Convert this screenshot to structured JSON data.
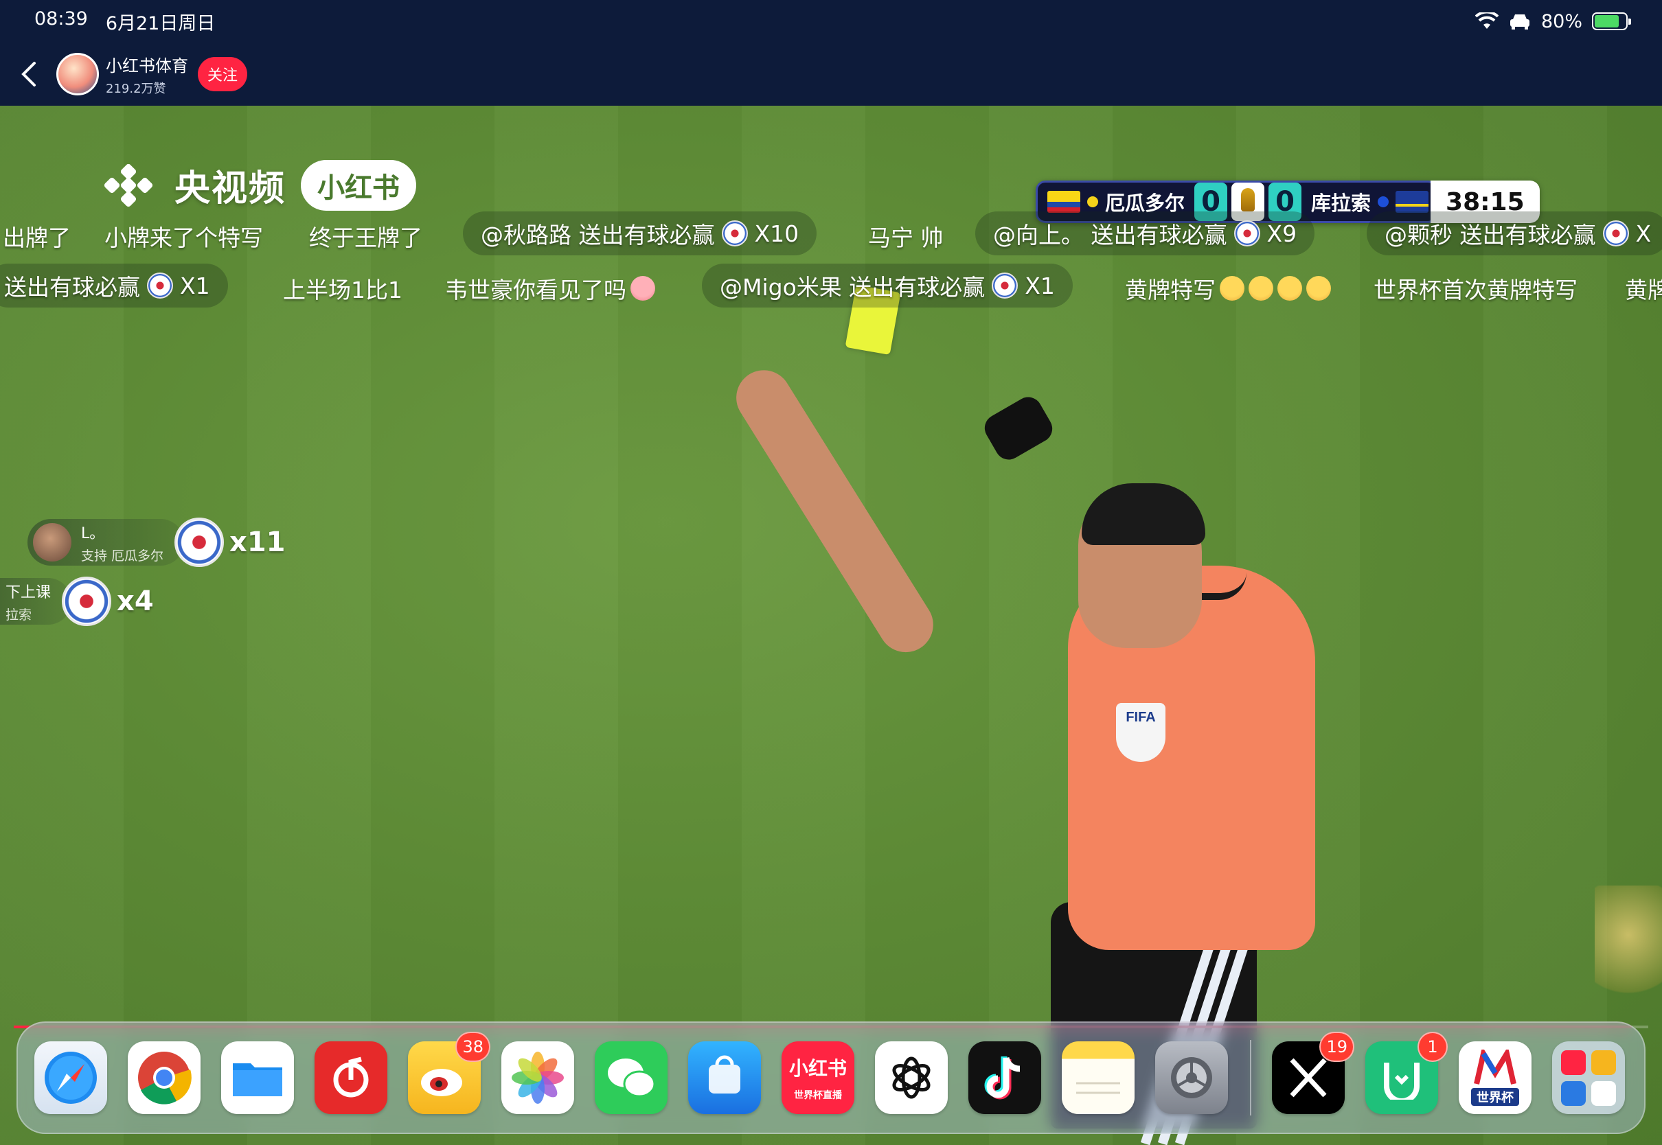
{
  "status_bar": {
    "time": "08:39",
    "date": "6月21日周日",
    "battery_percent": "80%",
    "battery_level": 0.8
  },
  "header": {
    "channel_name": "小红书体育",
    "channel_likes": "219.2万赞",
    "follow_label": "关注"
  },
  "watermark": {
    "text": "央视频",
    "badge": "小红书"
  },
  "scoreboard": {
    "team_left": "厄瓜多尔",
    "score_left": "0",
    "score_right": "0",
    "team_right": "库拉索",
    "match_time": "38:15",
    "dot_left_color": "#f5d21a",
    "dot_right_color": "#1d4fd8"
  },
  "danmaku_row1": [
    "出牌了",
    "小牌来了个特写",
    "终于王牌了",
    "@秋路路 送出有球必赢",
    "X10",
    "马宁 帅",
    "@向上。 送出有球必赢",
    "X9",
    "@颗秒 送出有球必赢",
    "X"
  ],
  "danmaku_row2": [
    "送出有球必赢",
    "X1",
    "上半场1比1",
    "韦世豪你看见了吗",
    "@Migo米果 送出有球必赢",
    "X1",
    "黄牌特写",
    "世界杯首次黄牌特写",
    "黄牌"
  ],
  "gifts": [
    {
      "name": "L。",
      "sub": "支持 厄瓜多尔",
      "count": "x11"
    },
    {
      "name": "下上课",
      "sub": "拉索",
      "count": "x4"
    }
  ],
  "video_progress": 0.99,
  "dock": {
    "apps": [
      {
        "name": "Safari",
        "icon": "compass-icon"
      },
      {
        "name": "Chrome",
        "icon": "chrome-icon"
      },
      {
        "name": "文件",
        "icon": "folder-icon"
      },
      {
        "name": "网易云音乐",
        "icon": "netease-music-icon"
      },
      {
        "name": "微博",
        "icon": "weibo-icon",
        "badge": "38"
      },
      {
        "name": "照片",
        "icon": "photos-icon"
      },
      {
        "name": "微信",
        "icon": "wechat-icon"
      },
      {
        "name": "App Store",
        "icon": "app-store-icon"
      },
      {
        "name": "小红书",
        "icon": "xiaohongshu-icon",
        "label": "小红书",
        "sublabel": "世界杯直播"
      },
      {
        "name": "ChatGPT",
        "icon": "chatgpt-icon"
      },
      {
        "name": "TikTok",
        "icon": "tiktok-icon"
      },
      {
        "name": "备忘录",
        "icon": "notes-icon"
      },
      {
        "name": "设置",
        "icon": "settings-icon"
      },
      {
        "name": "X",
        "icon": "x-icon",
        "badge": "19"
      },
      {
        "name": "米家",
        "icon": "mijia-icon",
        "badge": "1"
      },
      {
        "name": "世界杯",
        "icon": "worldcup-icon",
        "label": "世界杯"
      },
      {
        "name": "App Library",
        "icon": "app-library-icon"
      }
    ]
  },
  "colors": {
    "accent_red": "#ff2442",
    "nav_bg": "#0d1b3a",
    "pitch_green": "#5e8c36",
    "scoreboard_teal": "#2fd0c2"
  }
}
